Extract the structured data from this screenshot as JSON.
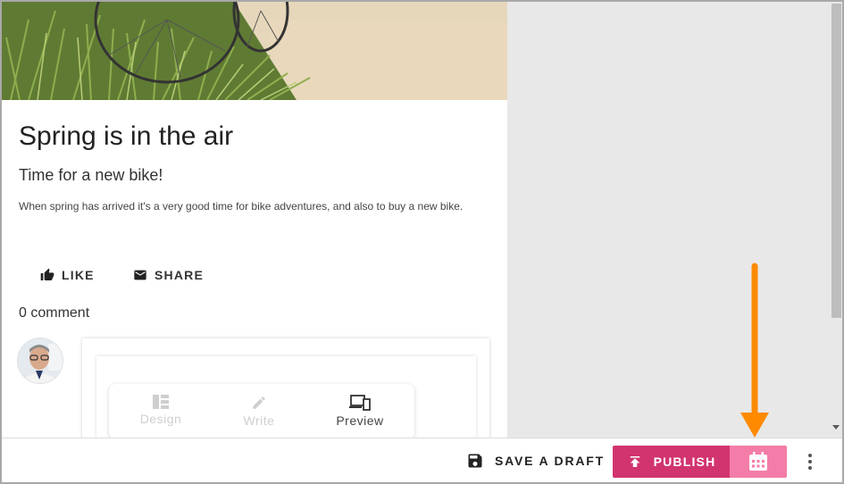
{
  "post": {
    "title": "Spring is in the air",
    "subtitle": "Time for a new bike!",
    "body": "When spring has arrived it's a very good time for bike adventures, and also to buy a new bike."
  },
  "actions": {
    "like_label": "LIKE",
    "share_label": "SHARE"
  },
  "comments": {
    "count_label": "0 comment"
  },
  "editor_modes": [
    {
      "label": "Design",
      "icon": "grid-layout-icon",
      "active": false
    },
    {
      "label": "Write",
      "icon": "pencil-icon",
      "active": false
    },
    {
      "label": "Preview",
      "icon": "devices-icon",
      "active": true
    }
  ],
  "toolbar": {
    "save_draft_label": "SAVE A DRAFT",
    "publish_label": "PUBLISH",
    "schedule_icon": "calendar-icon",
    "more_icon": "more-vertical-icon"
  },
  "colors": {
    "publish": "#d1346f",
    "schedule": "#f37da8",
    "annotation_arrow": "#ff8a00"
  }
}
